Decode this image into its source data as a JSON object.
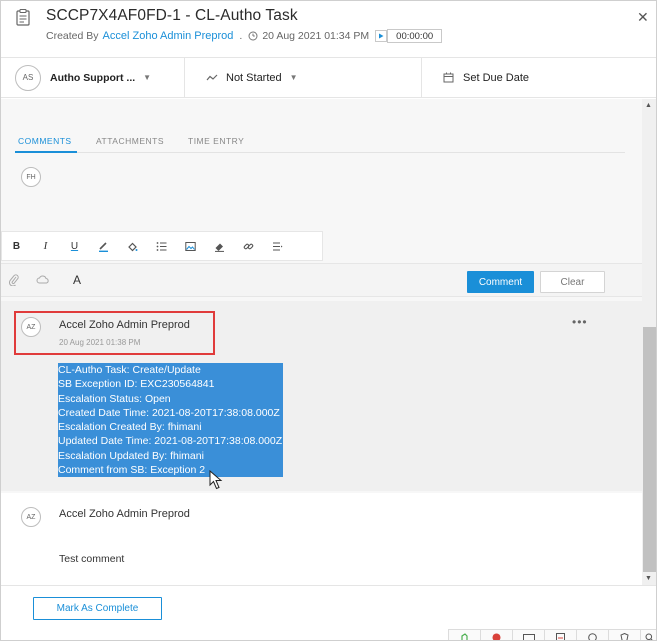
{
  "header": {
    "title": "SCCP7X4AF0FD-1 - CL-Autho Task",
    "created_by_prefix": "Created By",
    "creator": "Accel Zoho Admin Preprod",
    "separator": ".",
    "created_time": "20 Aug 2021 01:34 PM",
    "timer": "00:00:00",
    "close_icon": "close-icon"
  },
  "status_bar": {
    "assignee_initials": "AS",
    "assignee": "Autho Support ...",
    "status": "Not Started",
    "due_date_label": "Set Due Date"
  },
  "tabs": [
    {
      "label": "COMMENTS",
      "active": true
    },
    {
      "label": "ATTACHMENTS",
      "active": false
    },
    {
      "label": "TIME ENTRY",
      "active": false
    }
  ],
  "composer": {
    "user_initials": "FH",
    "toolbar": {
      "bold": "B",
      "italic": "I",
      "underline": "U",
      "icons": [
        "text-color-icon",
        "fill-color-icon",
        "bullet-list-icon",
        "image-icon",
        "eraser-icon",
        "link-icon",
        "more-format-icon"
      ]
    },
    "font_label": "A",
    "comment_button": "Comment",
    "clear_button": "Clear"
  },
  "comments": [
    {
      "initials": "AZ",
      "author": "Accel Zoho Admin Preprod",
      "time": "20 Aug 2021 01:38 PM",
      "lines": [
        "CL-Autho Task: Create/Update",
        "SB Exception ID: EXC230564841",
        "Escalation Status: Open",
        "Created Date Time: 2021-08-20T17:38:08.000Z",
        "Escalation Created By: fhimani",
        "Updated Date Time: 2021-08-20T17:38:08.000Z",
        "Escalation Updated By: fhimani",
        "Comment from SB: Exception 2"
      ],
      "more": "•••"
    },
    {
      "initials": "AZ",
      "author": "Accel Zoho Admin Preprod",
      "body": "Test comment"
    }
  ],
  "footer": {
    "complete_button": "Mark As Complete"
  },
  "colors": {
    "accent": "#1a8fd8",
    "selection": "#3a8fd8",
    "highlight_box": "#e03b3b"
  }
}
